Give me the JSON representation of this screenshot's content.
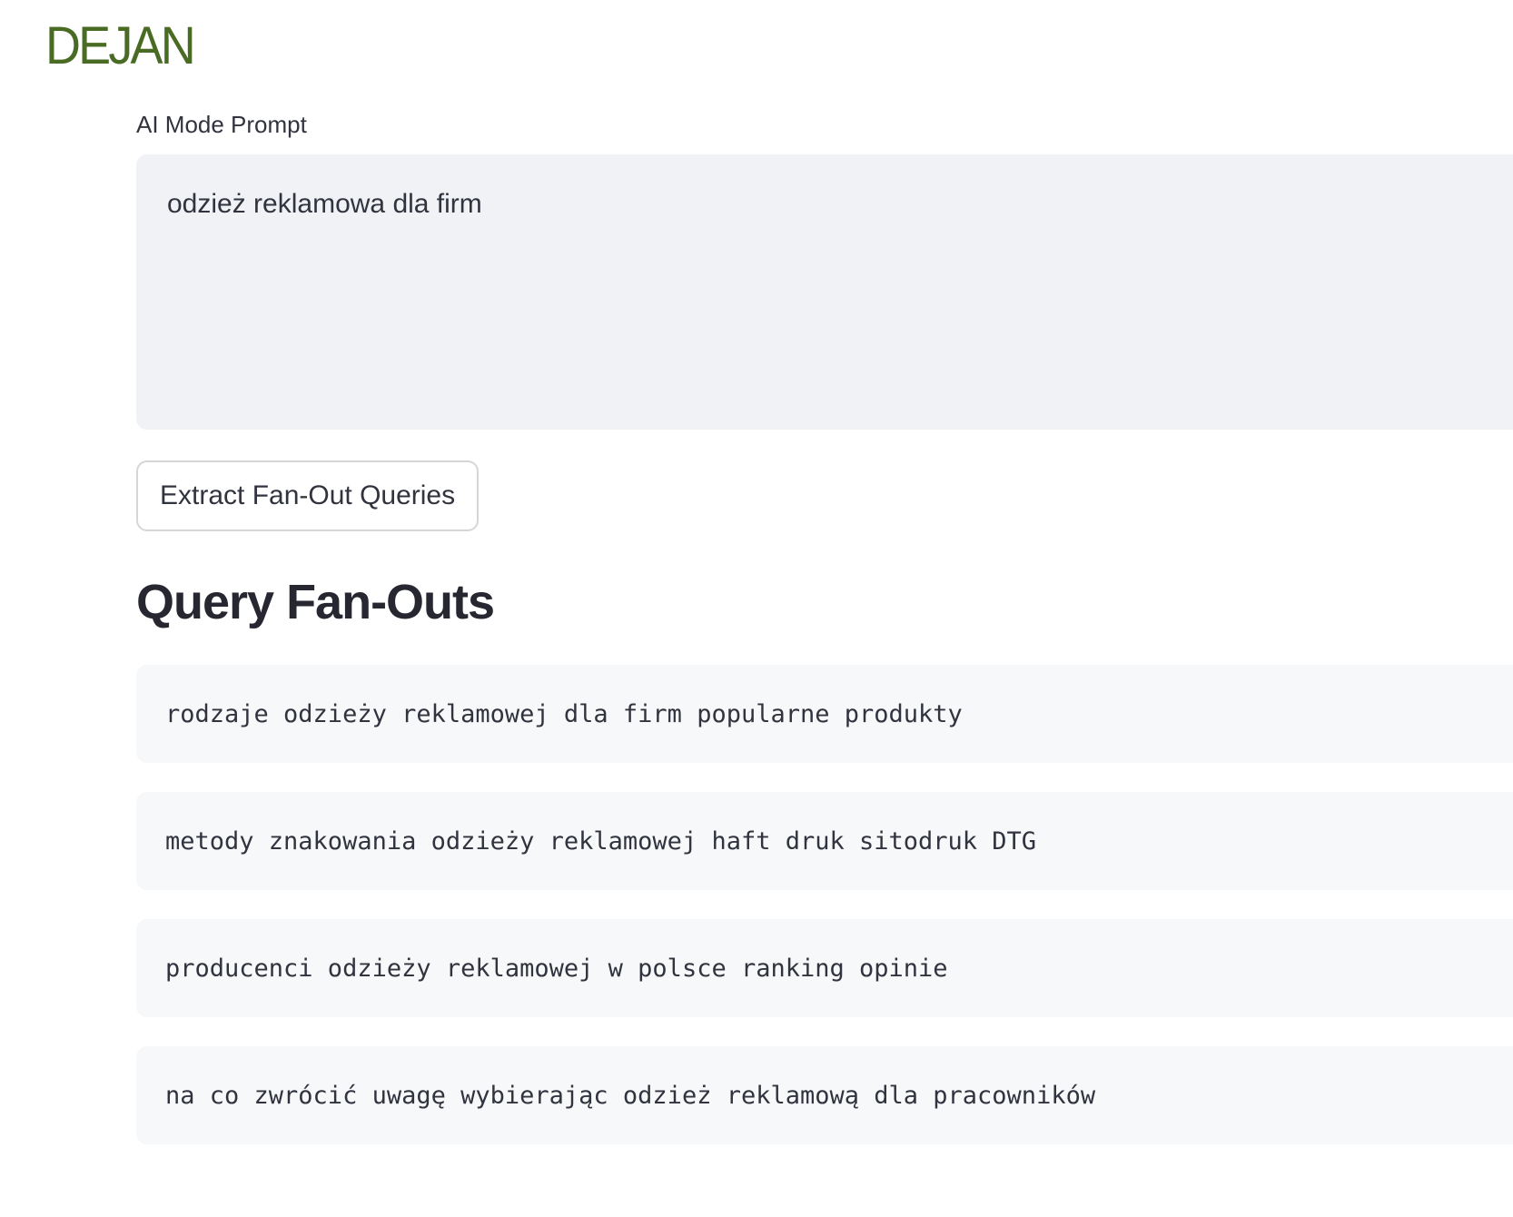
{
  "brand": {
    "logo_text": "DEJAN",
    "color": "#4a6b24"
  },
  "prompt": {
    "label": "AI Mode Prompt",
    "value": "odzież reklamowa dla firm"
  },
  "actions": {
    "extract_label": "Extract Fan-Out Queries"
  },
  "results": {
    "title": "Query Fan-Outs",
    "queries": [
      "rodzaje odzieży reklamowej dla firm popularne produkty",
      "metody znakowania odzieży reklamowej haft druk sitodruk DTG",
      "producenci odzieży reklamowej w polsce ranking opinie",
      "na co zwrócić uwagę wybierając odzież reklamową dla pracowników"
    ]
  }
}
